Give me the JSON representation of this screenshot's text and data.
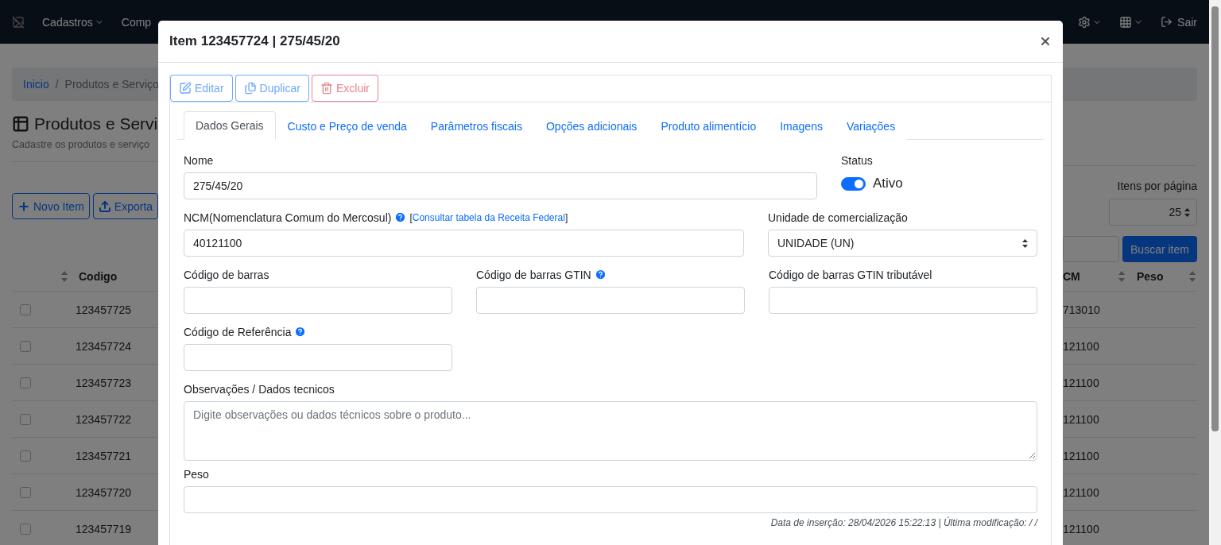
{
  "navbar": {
    "menus": [
      {
        "label": "Cadastros",
        "caret": true
      },
      {
        "label": "Comp",
        "caret": false
      }
    ],
    "logout": "Sair"
  },
  "page": {
    "breadcrumb": {
      "home": "Inicio",
      "separator": "/",
      "current": "Produtos e Serviço"
    },
    "title": "Produtos e Servi",
    "subtitle": "Cadastre os produtos e serviço",
    "buttons": [
      {
        "kind": "add",
        "label": "Novo Item"
      },
      {
        "kind": "export",
        "label": "Exporta"
      }
    ],
    "per_page": {
      "label": "Itens por página",
      "value": "25"
    },
    "search_button": "Buscar item",
    "table": {
      "left_column": "Codigo",
      "right_columns": [
        "CM",
        "Peso"
      ],
      "rows": [
        {
          "code": "123457725",
          "ncm": "713010",
          "checked": false
        },
        {
          "code": "123457724",
          "ncm": "121100",
          "checked": false
        },
        {
          "code": "123457723",
          "ncm": "121100",
          "checked": false
        },
        {
          "code": "123457722",
          "ncm": "121100",
          "checked": false
        },
        {
          "code": "123457721",
          "ncm": "121100",
          "checked": false
        },
        {
          "code": "123457720",
          "ncm": "121100",
          "checked": false
        },
        {
          "code": "123457719",
          "ncm": "121100",
          "checked": false
        }
      ]
    }
  },
  "modal": {
    "title": "Item 123457724 | 275/45/20",
    "actions": [
      {
        "kind": "edit",
        "label": "Editar"
      },
      {
        "kind": "duplicate",
        "label": "Duplicar"
      },
      {
        "kind": "delete",
        "label": "Excluir"
      }
    ],
    "tabs": [
      {
        "label": "Dados Gerais",
        "selected": true
      },
      {
        "label": "Custo e Preço de venda",
        "selected": false
      },
      {
        "label": "Parâmetros fiscais",
        "selected": false
      },
      {
        "label": "Opções adicionais",
        "selected": false
      },
      {
        "label": "Produto alimentício",
        "selected": false
      },
      {
        "label": "Imagens",
        "selected": false
      },
      {
        "label": "Variações",
        "selected": false
      }
    ],
    "name": {
      "label": "Nome",
      "value": "275/45/20"
    },
    "status": {
      "label": "Status",
      "on": true,
      "text": "Ativo"
    },
    "ncm": {
      "label": "NCM(Nomenclatura Comum do Mercosul)",
      "link_open": "[",
      "link": "Consultar tabela da Receita Federal",
      "link_close": "]",
      "value": "40121100"
    },
    "unit": {
      "label": "Unidade de comercialização",
      "value": "UNIDADE (UN)"
    },
    "barcodes": [
      {
        "label": "Código de barras",
        "help": false
      },
      {
        "label": "Código de barras GTIN",
        "help": true
      },
      {
        "label": "Código de barras GTIN tributável",
        "help": false
      }
    ],
    "reference": {
      "label": "Código de Referência",
      "help": true
    },
    "notes": {
      "label": "Observações / Dados tecnicos",
      "placeholder": "Digite observações ou dados técnicos sobre o produto..."
    },
    "weight": {
      "label": "Peso"
    },
    "footer": "Data de inserção: 28/04/2026 15:22:13 | Última modificação: / /"
  }
}
